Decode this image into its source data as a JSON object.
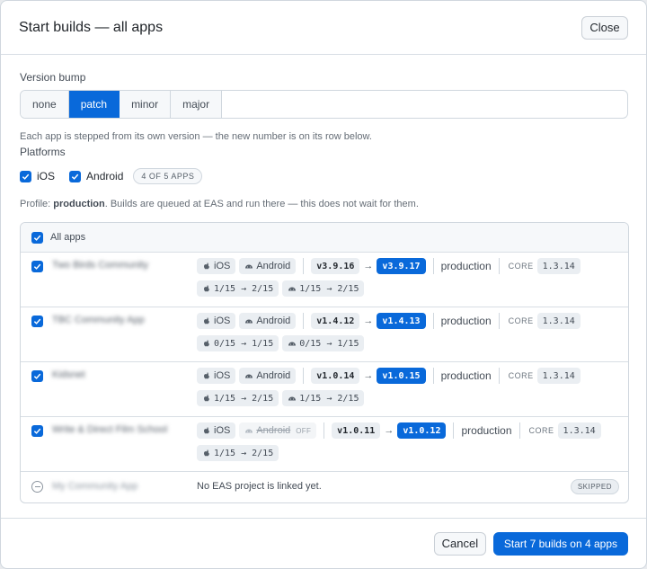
{
  "dialog": {
    "title": "Start builds — all apps",
    "close_label": "Close"
  },
  "version_bump": {
    "label": "Version bump",
    "options": [
      "none",
      "patch",
      "minor",
      "major"
    ],
    "selected": "patch",
    "hint": "Each app is stepped from its own version — the new number is on its row below."
  },
  "platforms": {
    "label": "Platforms",
    "ios_label": "iOS",
    "android_label": "Android",
    "ios_checked": true,
    "android_checked": true,
    "count_badge": "4 OF 5 APPS"
  },
  "profile": {
    "prefix": "Profile: ",
    "name": "production",
    "suffix": ". Builds are queued at EAS and run there — this does not wait for them."
  },
  "apps": {
    "all_label": "All apps",
    "rows": [
      {
        "name": "Two Birds Community",
        "ios": "iOS",
        "android": "Android",
        "android_off": false,
        "from": "v3.9.16",
        "to": "v3.9.17",
        "profile": "production",
        "core_label": "CORE",
        "core": "1.3.14",
        "ios_count": "1/15 → 2/15",
        "android_count": "1/15 → 2/15"
      },
      {
        "name": "TBC Community App",
        "ios": "iOS",
        "android": "Android",
        "android_off": false,
        "from": "v1.4.12",
        "to": "v1.4.13",
        "profile": "production",
        "core_label": "CORE",
        "core": "1.3.14",
        "ios_count": "0/15 → 1/15",
        "android_count": "0/15 → 1/15"
      },
      {
        "name": "Kidsnet",
        "ios": "iOS",
        "android": "Android",
        "android_off": false,
        "from": "v1.0.14",
        "to": "v1.0.15",
        "profile": "production",
        "core_label": "CORE",
        "core": "1.3.14",
        "ios_count": "1/15 → 2/15",
        "android_count": "1/15 → 2/15"
      },
      {
        "name": "Write & Direct Film School",
        "ios": "iOS",
        "android": "Android",
        "android_off": true,
        "off_label": "OFF",
        "from": "v1.0.11",
        "to": "v1.0.12",
        "profile": "production",
        "core_label": "CORE",
        "core": "1.3.14",
        "ios_count": "1/15 → 2/15"
      }
    ],
    "skipped_row": {
      "name": "My Community App",
      "message": "No EAS project is linked yet.",
      "badge": "SKIPPED"
    }
  },
  "footer": {
    "cancel_label": "Cancel",
    "start_label": "Start 7 builds on 4 apps"
  },
  "colors": {
    "accent": "#0969da"
  }
}
